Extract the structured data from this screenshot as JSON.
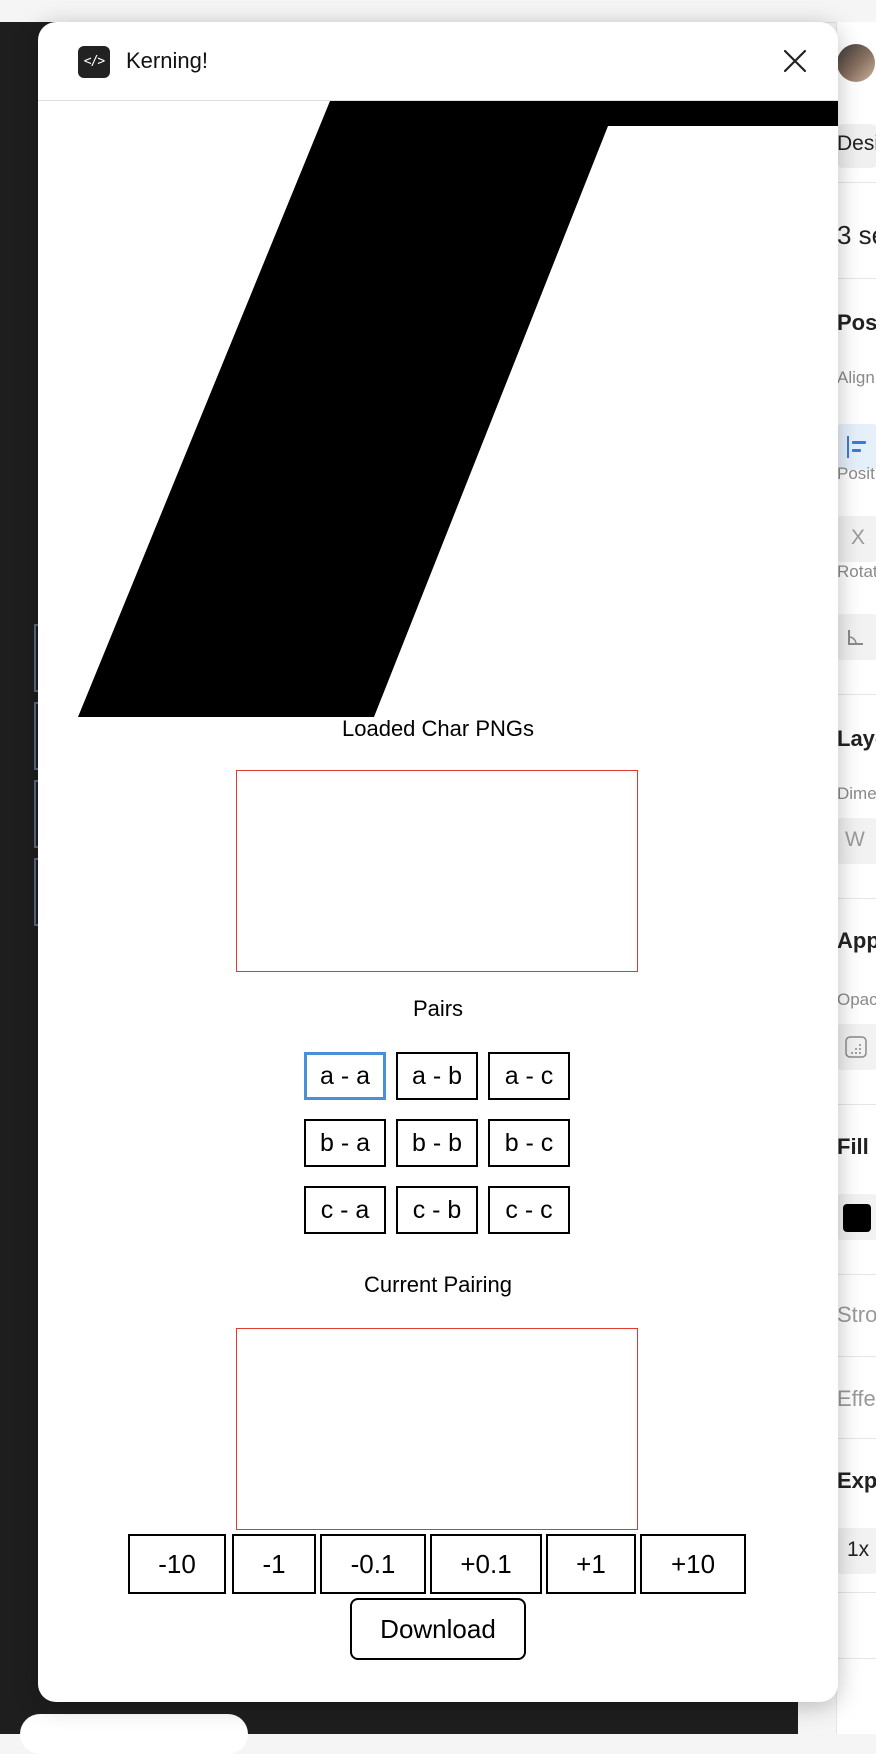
{
  "modal": {
    "title": "Kerning!",
    "app_icon": "</>",
    "close_icon": "close-icon"
  },
  "sections": {
    "loaded_title": "Loaded Char PNGs",
    "pairs_title": "Pairs",
    "current_title": "Current Pairing"
  },
  "pairs": [
    [
      "a - a",
      "a - b",
      "a - c"
    ],
    [
      "b - a",
      "b - b",
      "b - c"
    ],
    [
      "c - a",
      "c - b",
      "c - c"
    ]
  ],
  "selected_pair": "a - a",
  "adjust_buttons": [
    "-10",
    "-1",
    "-0.1",
    "+0.1",
    "+1",
    "+10"
  ],
  "download_label": "Download",
  "right_panel": {
    "tab": "Desi",
    "selection": "3 se",
    "position_heading": "Posi",
    "align_label": "Align",
    "position_label": "Posit",
    "x_label": "X",
    "rotation_label": "Rotat",
    "rotation_icon": "angle-icon",
    "layout_heading": "Layo",
    "dimensions_label": "Dime",
    "w_label": "W",
    "appearance_heading": "App",
    "opacity_label": "Opac",
    "fill_heading": "Fill",
    "fill_color": "#000000",
    "stroke_heading": "Stro",
    "effects_heading": "Effe",
    "export_heading": "Expo",
    "export_scale": "1x"
  },
  "colors": {
    "accent": "#4a90d9",
    "box_border": "#e03a2e",
    "canvas": "#1e1e1e"
  }
}
